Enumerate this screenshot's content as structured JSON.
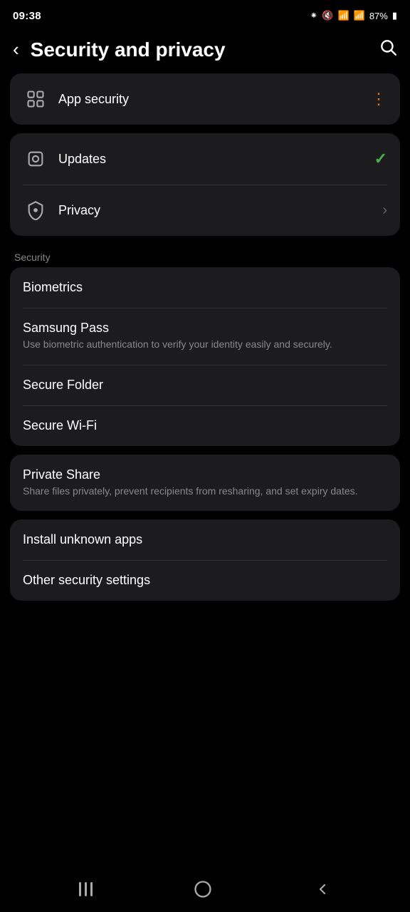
{
  "statusBar": {
    "time": "09:38",
    "battery": "87%"
  },
  "header": {
    "backLabel": "‹",
    "title": "Security and privacy",
    "searchLabel": "⌕"
  },
  "topCard": {
    "items": [
      {
        "id": "app-security",
        "title": "App security",
        "subtitle": "",
        "endType": "dots",
        "iconType": "apps"
      }
    ]
  },
  "updatePrivacyCard": {
    "items": [
      {
        "id": "updates",
        "title": "Updates",
        "subtitle": "",
        "endType": "check",
        "iconType": "update"
      },
      {
        "id": "privacy",
        "title": "Privacy",
        "subtitle": "",
        "endType": "chevron",
        "iconType": "shield"
      }
    ]
  },
  "sectionLabel": "Security",
  "securityCard": {
    "items": [
      {
        "id": "biometrics",
        "title": "Biometrics",
        "subtitle": "",
        "endType": "none",
        "iconType": "none"
      },
      {
        "id": "samsung-pass",
        "title": "Samsung Pass",
        "subtitle": "Use biometric authentication to verify your identity easily and securely.",
        "endType": "none",
        "iconType": "none"
      },
      {
        "id": "secure-folder",
        "title": "Secure Folder",
        "subtitle": "",
        "endType": "none",
        "iconType": "none"
      },
      {
        "id": "secure-wifi",
        "title": "Secure Wi-Fi",
        "subtitle": "",
        "endType": "none",
        "iconType": "none"
      }
    ]
  },
  "privateShareCard": {
    "items": [
      {
        "id": "private-share",
        "title": "Private Share",
        "subtitle": "Share files privately, prevent recipients from resharing, and set expiry dates.",
        "endType": "none"
      }
    ]
  },
  "bottomCard": {
    "items": [
      {
        "id": "install-unknown-apps",
        "title": "Install unknown apps",
        "subtitle": "",
        "endType": "none"
      },
      {
        "id": "other-security-settings",
        "title": "Other security settings",
        "subtitle": "",
        "endType": "none"
      }
    ]
  },
  "navBar": {
    "recentLabel": "|||",
    "homeLabel": "○",
    "backLabel": "<"
  }
}
